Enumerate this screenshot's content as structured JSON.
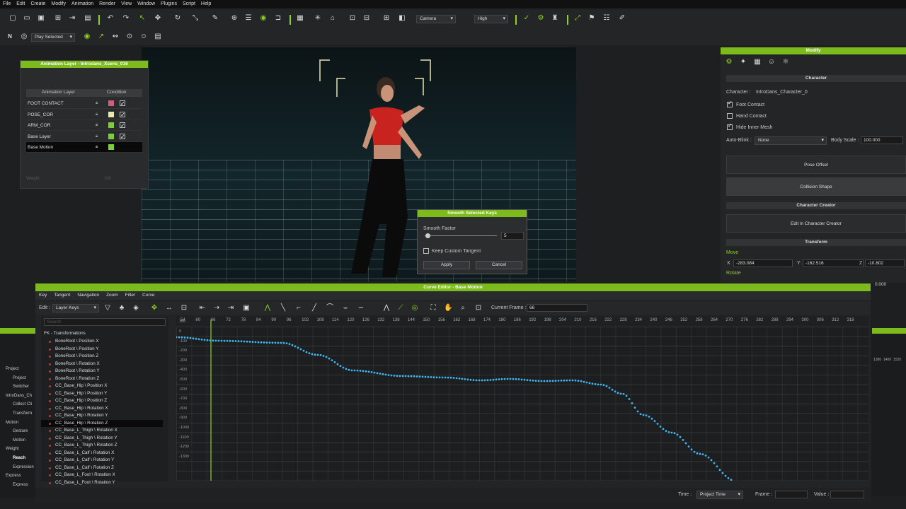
{
  "menu": [
    "File",
    "Edit",
    "Create",
    "Modify",
    "Animation",
    "Render",
    "View",
    "Window",
    "Plugins",
    "Script",
    "Help"
  ],
  "toolbar": {
    "camera": "Camera",
    "quality": "High",
    "play_mode": "Play Selected"
  },
  "anim_layer": {
    "title": "Animation Layer - Introdans_Xsens_016",
    "col_layer": "Animation Layer",
    "col_condition": "Condition",
    "rows": [
      {
        "name": "FOOT CONTACT",
        "color": "#d0607a"
      },
      {
        "name": "POSE_COR",
        "color": "#e8e8b0"
      },
      {
        "name": "ARM_COR",
        "color": "#7dcf3a"
      },
      {
        "name": "Base Layer",
        "color": "#7dcf3a"
      },
      {
        "name": "Base Motion",
        "color": "#7dcf3a"
      }
    ],
    "weight_label": "Weight",
    "weight_value": "100"
  },
  "dialog": {
    "title": "Smooth Selected Keys",
    "factor_label": "Smooth Factor",
    "factor_value": "5",
    "keep_label": "Keep Custom Tangent",
    "apply": "Apply",
    "cancel": "Cancel"
  },
  "modify": {
    "title": "Modify",
    "sec_character": "Character",
    "character_label": "Character :",
    "character_value": "IntroDans_Character_0",
    "foot_contact": "Foot Contact",
    "hand_contact": "Hand Contact",
    "hide_inner": "Hide Inner Mesh",
    "autoblink_label": "Auto-Blink :",
    "autoblink_value": "None",
    "bodyscale_label": "Body Scale :",
    "bodyscale_value": "100.000",
    "pose_offset": "Pose Offset",
    "collision": "Collision Shape",
    "sec_cc": "Character Creator",
    "edit_cc": "Edit in Character Creator",
    "sec_transform": "Transform",
    "move": "Move",
    "x_label": "X",
    "x_value": "-283.084",
    "y_label": "Y",
    "y_value": "-162.516",
    "z_label": "Z",
    "z_value": "-10.802",
    "rotate": "Rotate",
    "rot_value": "0.000"
  },
  "curve": {
    "title": "Curve Editor - Base Motion",
    "menu": [
      "Key",
      "Tangent",
      "Navigation",
      "Zoom",
      "Filter",
      "Curve"
    ],
    "edit_label": "Edit :",
    "edit_value": "Layer Keys",
    "current_frame_label": "Current Frame :",
    "current_frame": "66",
    "search_placeholder": "Search",
    "tree_root": "FK - Transformations",
    "tracks": [
      "BoneRoot \\ Position X",
      "BoneRoot \\ Position Y",
      "BoneRoot \\ Position Z",
      "BoneRoot \\ Rotation X",
      "BoneRoot \\ Rotation Y",
      "BoneRoot \\ Rotation Z",
      "CC_Base_Hip \\ Position X",
      "CC_Base_Hip \\ Position Y",
      "CC_Base_Hip \\ Position Z",
      "CC_Base_Hip \\ Rotation X",
      "CC_Base_Hip \\ Rotation Y",
      "CC_Base_Hip \\ Rotation Z",
      "CC_Base_L_Thigh \\ Rotation X",
      "CC_Base_L_Thigh \\ Rotation Y",
      "CC_Base_L_Thigh \\ Rotation Z",
      "CC_Base_L_Calf \\ Rotation X",
      "CC_Base_L_Calf \\ Rotation Y",
      "CC_Base_L_Calf \\ Rotation Z",
      "CC_Base_L_Foot \\ Rotation X",
      "CC_Base_L_Foot \\ Rotation Y"
    ],
    "selected_track": 11,
    "ruler": [
      "54",
      "60",
      "66",
      "72",
      "78",
      "84",
      "90",
      "96",
      "102",
      "108",
      "114",
      "120",
      "126",
      "132",
      "138",
      "144",
      "150",
      "156",
      "162",
      "168",
      "174",
      "180",
      "186",
      "192",
      "198",
      "204",
      "210",
      "216",
      "222",
      "228",
      "234",
      "240",
      "246",
      "252",
      "258",
      "264",
      "270",
      "276",
      "282",
      "288",
      "294",
      "300",
      "306",
      "312",
      "318"
    ],
    "yaxis": [
      "100",
      "0",
      "-100",
      "-200",
      "-300",
      "-400",
      "-500",
      "-600",
      "-700",
      "-800",
      "-900",
      "-1000",
      "-1100",
      "-1200",
      "-1300"
    ],
    "time_label": "Time :",
    "time_value": "Project Time",
    "frame_label": "Frame :",
    "value_label": "Value :"
  },
  "left_panel": [
    "Project",
    "Project",
    "Switcher",
    "IntroDans_Ch",
    "Collect Cli",
    "Transform",
    "Motion",
    "Gesture",
    "Motion",
    "Weight",
    "Reach",
    "Expression",
    "Express",
    "Express"
  ],
  "right_mini": [
    "1380",
    "1400",
    "1520"
  ]
}
